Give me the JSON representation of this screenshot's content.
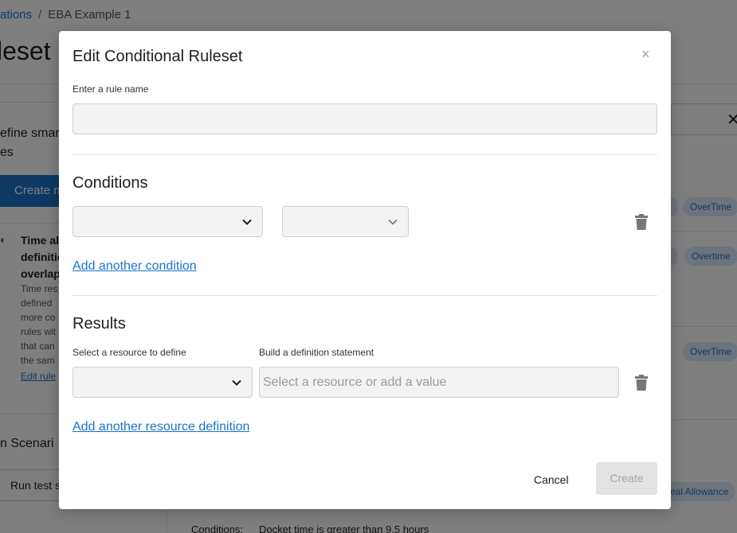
{
  "background": {
    "breadcrumb": {
      "parent": "ations",
      "separator": "/",
      "current": "EBA Example 1"
    },
    "page_title": "leset",
    "define_text": "efine smar es",
    "create_button": "Create n",
    "info_icon": "toggle-icon",
    "info_title": "Time al definitio overlap",
    "info_body": "Time res defined more co rules wit that can the sam",
    "edit_rule_link": "Edit rule",
    "scenario_title": "n Scenari",
    "run_test_button": "Run test s",
    "close_symbol": "✕",
    "tags": [
      "OverTime",
      "Overtime",
      "OverTime",
      "eal Allowance"
    ],
    "bottom_conditions_label": "Conditions:",
    "bottom_conditions_text": "Docket time is greater than 9.5 hours"
  },
  "modal": {
    "title": "Edit Conditional Ruleset",
    "close_symbol": "×",
    "rule_name_label": "Enter a rule name",
    "rule_name_value": "",
    "conditions_title": "Conditions",
    "condition_selects": [
      "",
      ""
    ],
    "add_condition_link": "Add another condition",
    "results_title": "Results",
    "resource_label": "Select a resource to define",
    "definition_label": "Build a definition statement",
    "resource_select_value": "",
    "definition_placeholder": "Select a resource or add a value",
    "add_resource_link": "Add another resource definition",
    "cancel_label": "Cancel",
    "create_label": "Create"
  },
  "colors": {
    "accent": "#1a73c9",
    "overlay": "rgba(0,0,0,0.5)",
    "disabled_button_bg": "#e3e3e3",
    "disabled_button_text": "#a5a5a5",
    "tag_bg": "#dbe9f7"
  }
}
